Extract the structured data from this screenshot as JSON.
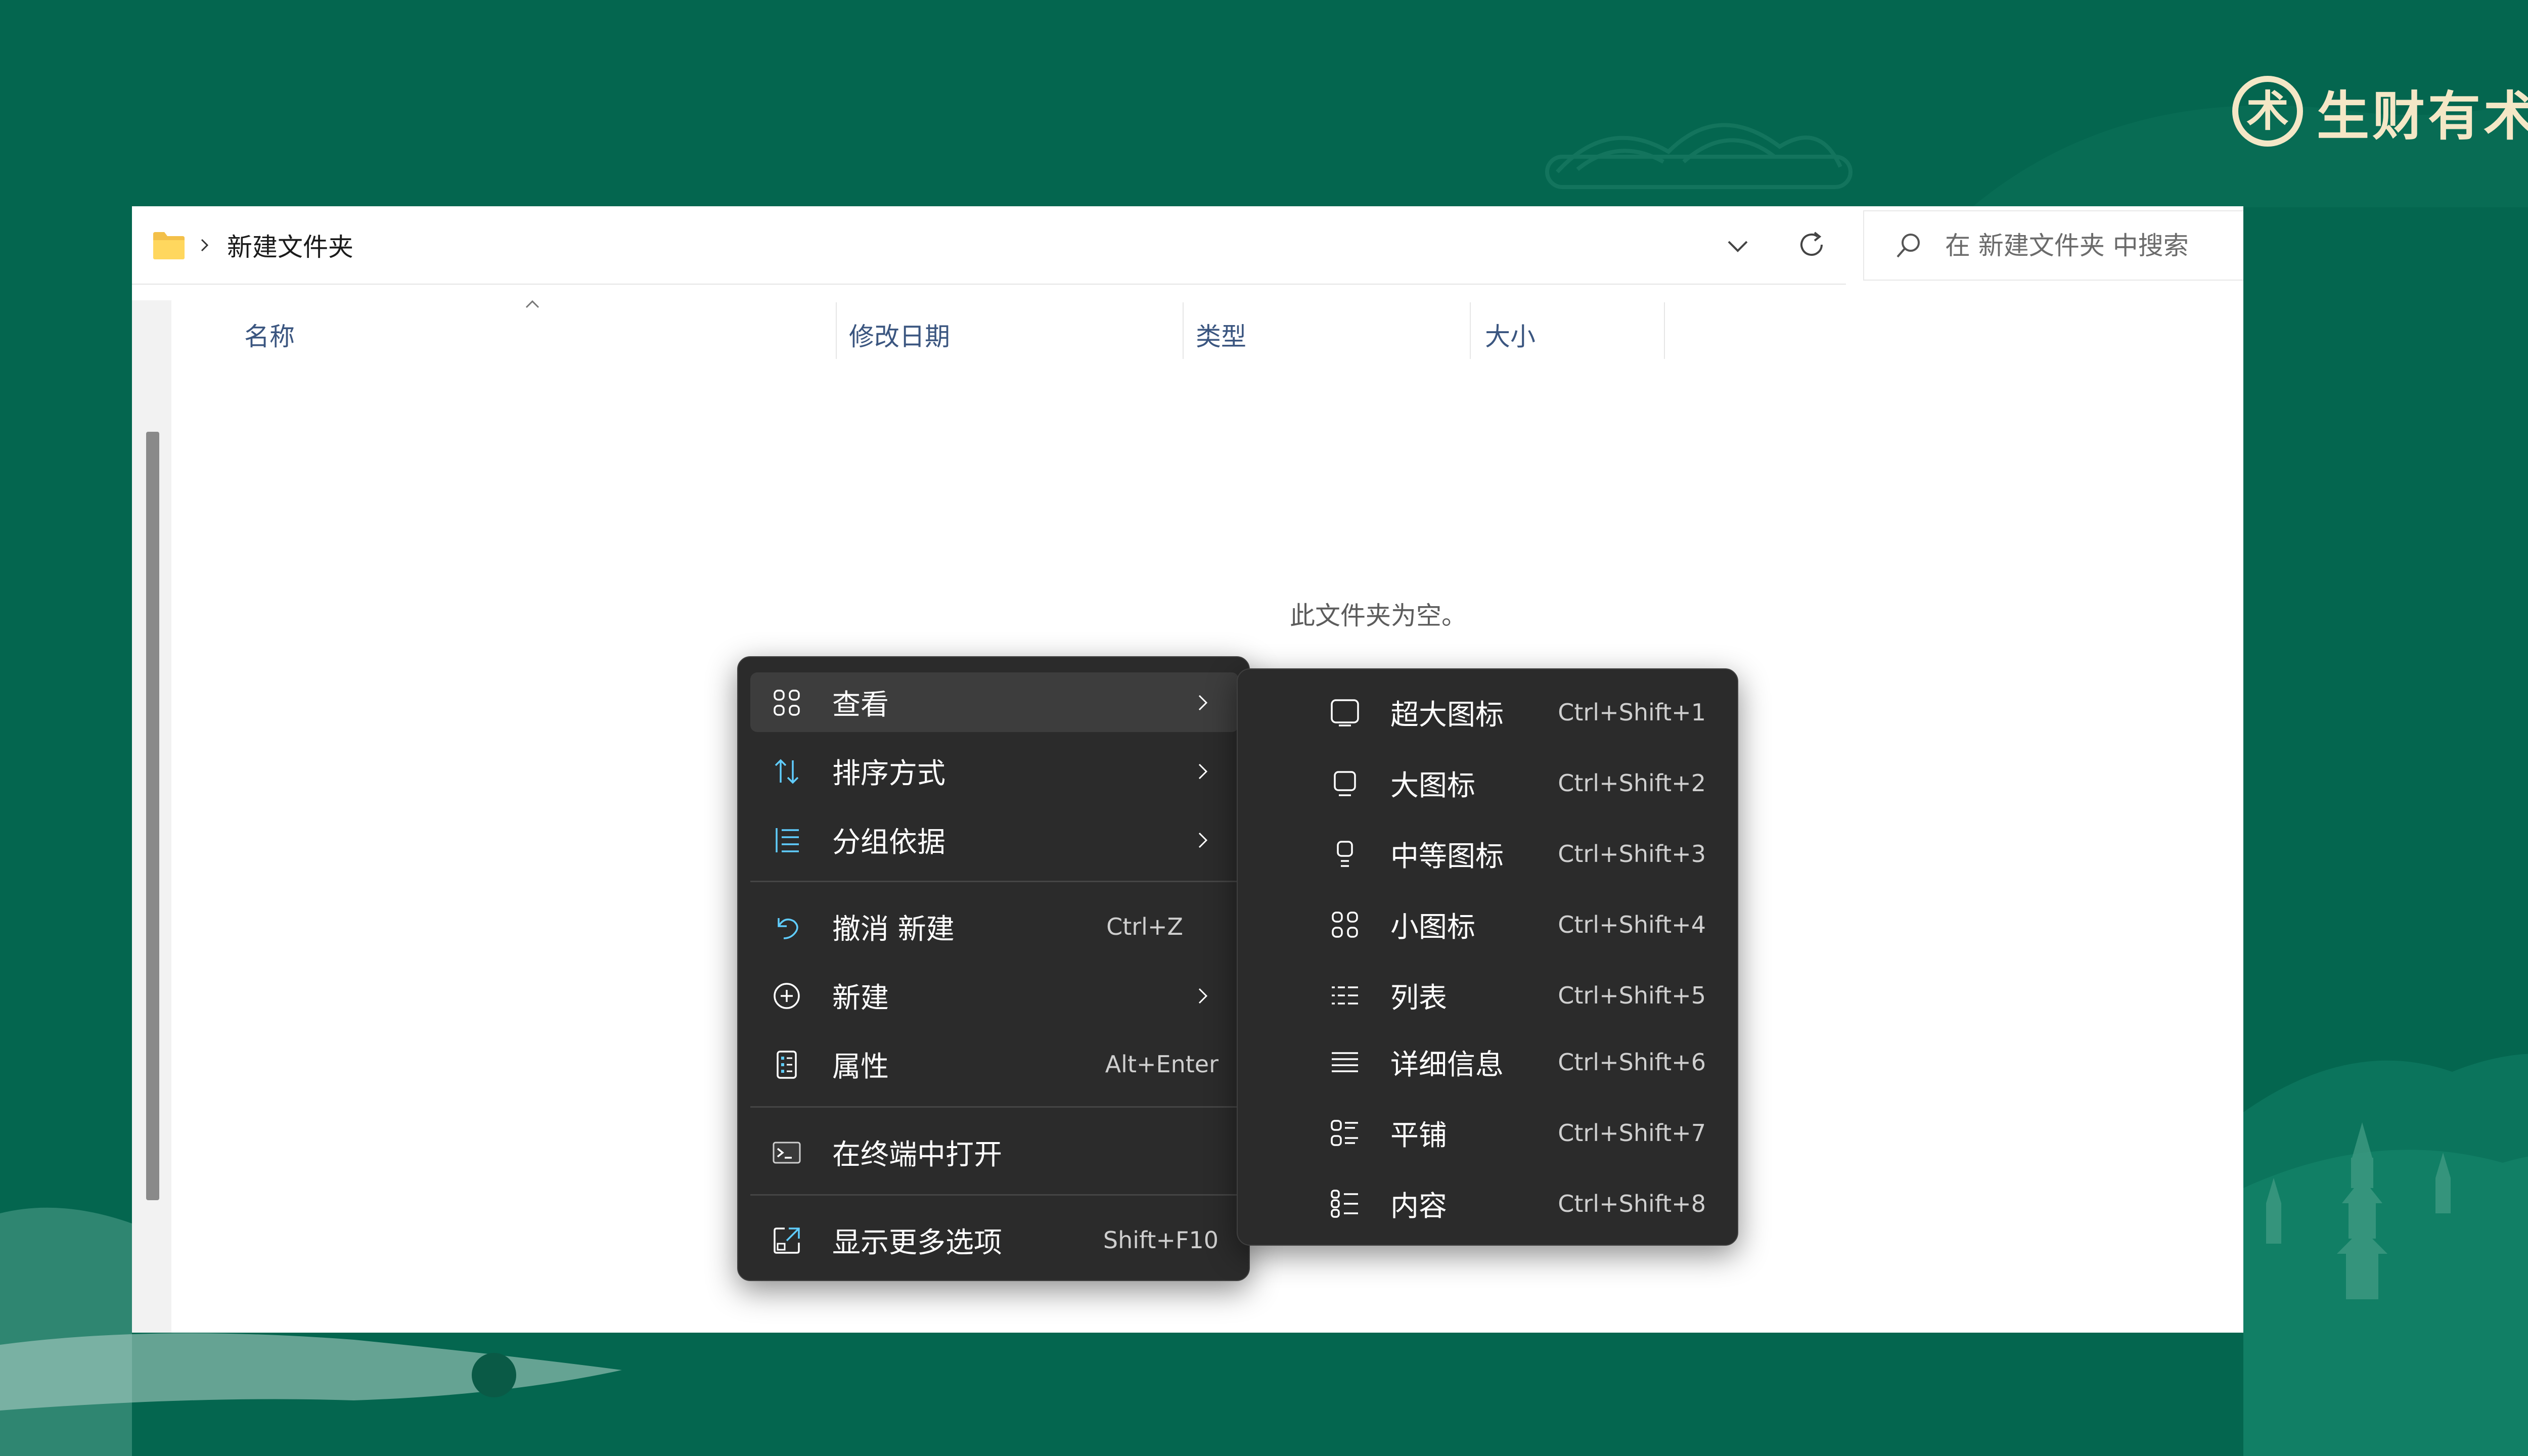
{
  "brand": {
    "name": "生财有术",
    "logo_glyph": "术",
    "color": "#f4e7c6"
  },
  "explorer": {
    "breadcrumb": [
      "新建文件夹"
    ],
    "search_placeholder": "在 新建文件夹 中搜索",
    "columns": [
      "名称",
      "修改日期",
      "类型",
      "大小"
    ],
    "empty_message": "此文件夹为空。"
  },
  "context_menu": {
    "items": [
      {
        "label": "查看",
        "icon": "view-grid-icon",
        "has_submenu": true,
        "highlighted": true
      },
      {
        "label": "排序方式",
        "icon": "sort-arrows-icon",
        "has_submenu": true
      },
      {
        "label": "分组依据",
        "icon": "group-list-icon",
        "has_submenu": true
      },
      {
        "label": "撤消 新建",
        "icon": "undo-icon",
        "shortcut": "Ctrl+Z"
      },
      {
        "label": "新建",
        "icon": "add-circle-icon",
        "has_submenu": true
      },
      {
        "label": "属性",
        "icon": "properties-icon",
        "shortcut": "Alt+Enter"
      },
      {
        "label": "在终端中打开",
        "icon": "terminal-icon"
      },
      {
        "label": "显示更多选项",
        "icon": "more-options-icon",
        "shortcut": "Shift+F10"
      }
    ]
  },
  "view_submenu": {
    "items": [
      {
        "label": "超大图标",
        "icon": "extra-large-icons-icon",
        "shortcut": "Ctrl+Shift+1"
      },
      {
        "label": "大图标",
        "icon": "large-icons-icon",
        "shortcut": "Ctrl+Shift+2"
      },
      {
        "label": "中等图标",
        "icon": "medium-icons-icon",
        "shortcut": "Ctrl+Shift+3"
      },
      {
        "label": "小图标",
        "icon": "small-icons-icon",
        "shortcut": "Ctrl+Shift+4"
      },
      {
        "label": "列表",
        "icon": "list-view-icon",
        "shortcut": "Ctrl+Shift+5"
      },
      {
        "label": "详细信息",
        "icon": "details-view-icon",
        "shortcut": "Ctrl+Shift+6"
      },
      {
        "label": "平铺",
        "icon": "tiles-view-icon",
        "shortcut": "Ctrl+Shift+7"
      },
      {
        "label": "内容",
        "icon": "content-view-icon",
        "shortcut": "Ctrl+Shift+8"
      }
    ]
  },
  "colors": {
    "background": "#04664f",
    "menu": "#2b2b2b",
    "accent": "#60cdff"
  }
}
